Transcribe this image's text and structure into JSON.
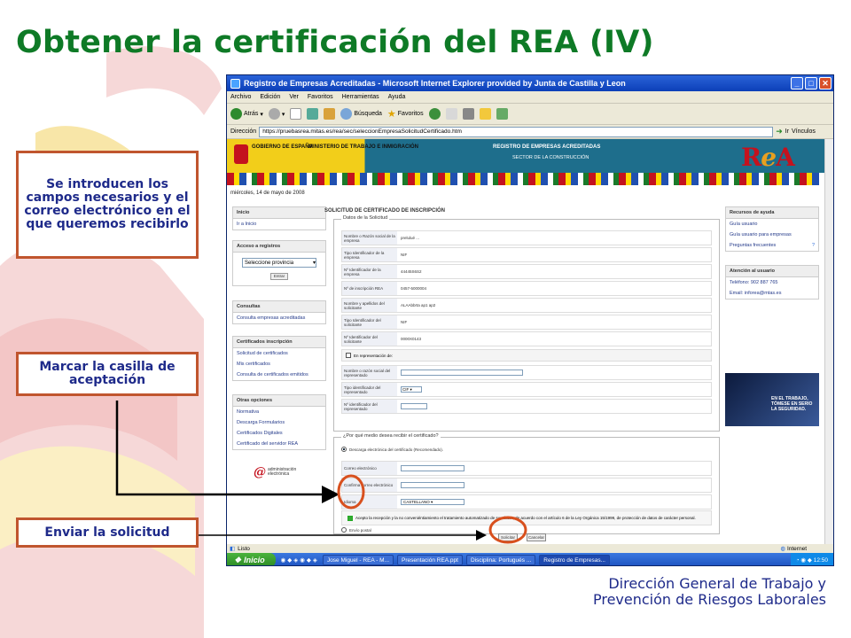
{
  "slide": {
    "title": "Obtener la certificación del REA (IV)",
    "callouts": {
      "campos": "Se introducen los campos necesarios y el correo electrónico en el que queremos recibirlo",
      "casilla": "Marcar la casilla de aceptación",
      "enviar": "Enviar la solicitud"
    },
    "footer": {
      "line1": "Dirección General de Trabajo y",
      "line2": "Prevención de Riesgos Laborales"
    }
  },
  "browser": {
    "title": "Registro de Empresas Acreditadas - Microsoft Internet Explorer provided by Junta de Castilla y Leon",
    "menu": [
      "Archivo",
      "Edición",
      "Ver",
      "Favoritos",
      "Herramientas",
      "Ayuda"
    ],
    "toolbar": {
      "back": "Atrás",
      "search": "Búsqueda",
      "favorites": "Favoritos"
    },
    "address_label": "Dirección",
    "url": "https://pruebasrea.mitas.es/rea/sec/seleccionEmpresaSolicitudCertificado.htm",
    "go": "Ir",
    "links": "Vínculos",
    "status": "Listo",
    "zone": "Internet"
  },
  "taskbar": {
    "start": "Inicio",
    "tasks": [
      "Jose Miguel - REA - M...",
      "Presentación REA.ppt",
      "Disciplina: Portugués ...",
      "Registro de Empresas..."
    ],
    "clock": "12:50"
  },
  "page": {
    "banner": {
      "gobierno": "GOBIERNO DE ESPAÑA",
      "ministerio": "MINISTERIO DE TRABAJO E INMIGRACIÓN",
      "title": "REGISTRO DE EMPRESAS ACREDITADAS",
      "subtitle": "SECTOR DE LA CONSTRUCCIÓN",
      "logo_r": "R",
      "logo_e": "e",
      "logo_a": "A"
    },
    "date": "miércoles, 14 de mayo de 2008",
    "left_nav": {
      "inicio": {
        "header": "Inicio",
        "items": [
          "Ir a Inicio"
        ]
      },
      "acceso": {
        "header": "Acceso a registros",
        "select": "Seleccione provincia",
        "button": "Entrar"
      },
      "consultas": {
        "header": "Consultas",
        "items": [
          "Consulta empresas acreditadas"
        ]
      },
      "certificados": {
        "header": "Certificados inscripción",
        "items": [
          "Solicitud de certificados",
          "Mis certificados",
          "Consulta de certificados emitidos"
        ]
      },
      "otras": {
        "header": "Otras opciones",
        "items": [
          "Normativa",
          "Descarga Formularios",
          "Certificados Digitales",
          "Certificado del servidor REA"
        ]
      },
      "admin_logo": "administración electrónica"
    },
    "right_nav": {
      "recursos": {
        "header": "Recursos de ayuda",
        "items": [
          "Guía usuario",
          "Guía usuario para empresas",
          "Preguntas frecuentes"
        ]
      },
      "atencion": {
        "header": "Atención al usuario",
        "items": [
          "Teléfono: 902 887 765",
          "Email: inforea@mtas.es"
        ]
      },
      "promo": "EN EL TRABAJO, TÓMESE EN SERIO LA SEGURIDAD."
    },
    "form": {
      "title": "SOLICITUD DE CERTIFICADO DE INSCRIPCIÓN",
      "datos_legend": "Datos de la Solicitud",
      "rows": [
        {
          "label": "Nombre o Razón social de la empresa",
          "value": "prelulué ..."
        },
        {
          "label": "Tipo Identificador de la empresa",
          "value": "NIF"
        },
        {
          "label": "Nº Identificador de la empresa",
          "value": "44445S6S2"
        },
        {
          "label": "Nº de inscripción REA",
          "value": "0457-5000004"
        },
        {
          "label": "Nombre y apellidos del solicitante",
          "value": "ALAAbbrta ap1 ap2"
        },
        {
          "label": "Tipo Identificador del solicitante",
          "value": "NIF"
        },
        {
          "label": "Nº Identificador del solicitante",
          "value": "0000X0143"
        }
      ],
      "representacion": "En representación de:",
      "rep_rows": [
        {
          "label": "Nombre o razón social del representado"
        },
        {
          "label": "Tipo identificador del representado",
          "value": "CIF"
        },
        {
          "label": "Nº identificador del representado"
        }
      ],
      "medio_legend": "¿Por qué medio desea recibir el certificado?",
      "descarga": "Descarga electrónica del certificado (Recomendado).",
      "correo": "Correo electrónico",
      "confirma": "Confirma correo electrónico",
      "idioma_label": "Idioma",
      "idioma": "CASTELLANO",
      "acepto": "Acepto la recepción y la no conveniéntiamiento el tratamiento automatizado de sus datos, de acuerdo con el artículo 6 de la Ley Orgánica 15/1999, de protección de datos de carácter personal.",
      "postal": "Envío postal",
      "solicitar": "Solicitar",
      "cancelar": "Cancelar"
    }
  },
  "colors": {
    "title": "#0e7a26",
    "callout_border": "#c0552e",
    "callout_text": "#1e2a8a",
    "highlight": "#d8501e"
  }
}
